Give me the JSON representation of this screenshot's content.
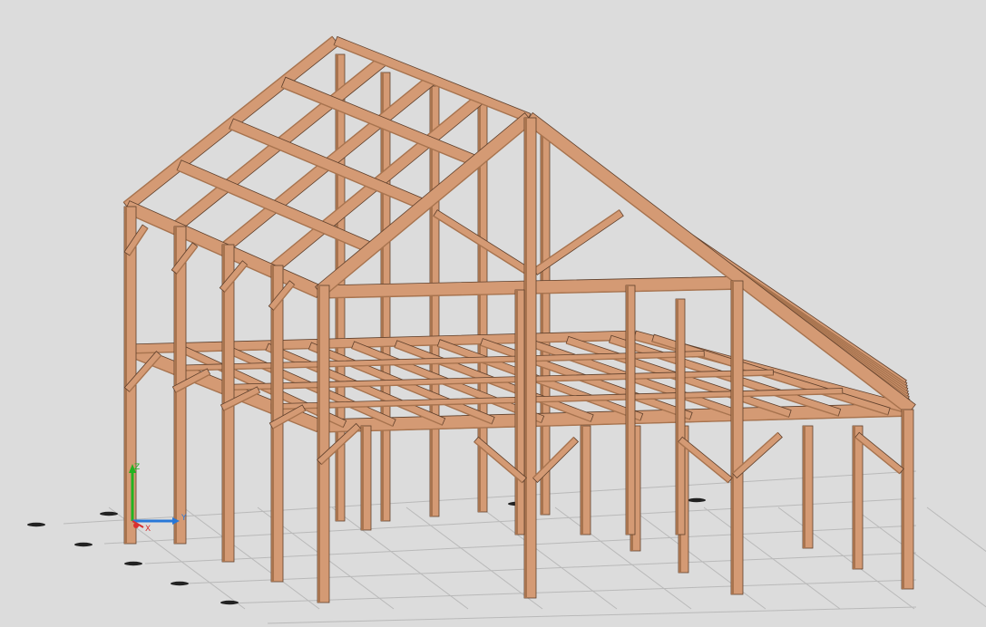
{
  "viewport": {
    "background": "#dcdcdc",
    "view": "3d-isometric",
    "model": "timber-frame-structure"
  },
  "colors": {
    "timber_face": "#d49a74",
    "timber_side": "#a8744f",
    "timber_dark": "#5e3f2b",
    "grid": "#b8b8b8",
    "axis_x": "#d83030",
    "axis_y": "#2878d8",
    "axis_z": "#22b422"
  },
  "axes": {
    "x_label": "X",
    "y_label": "Y",
    "z_label": "Z"
  }
}
